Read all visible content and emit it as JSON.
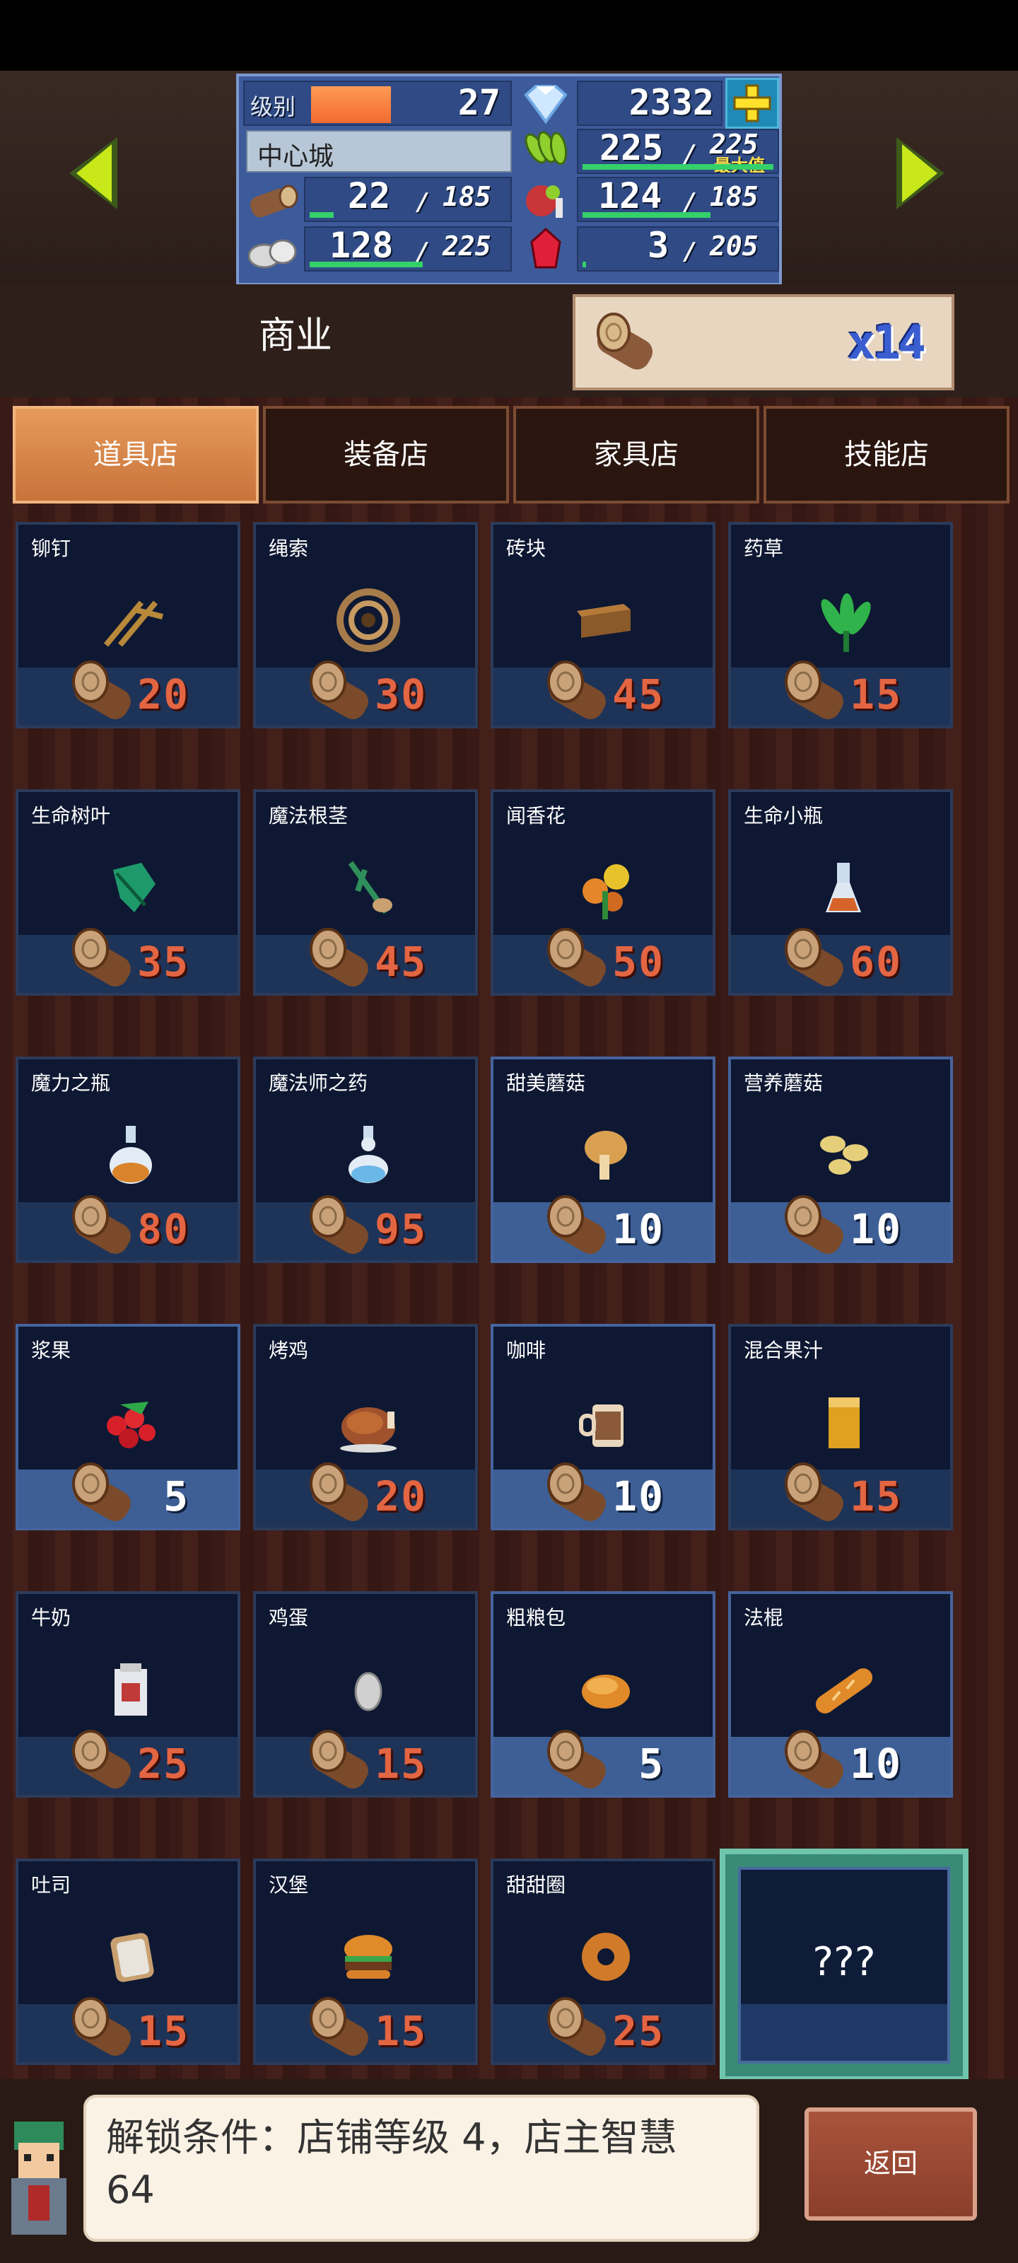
{
  "header": {
    "level_label": "级别",
    "level": "27",
    "level_progress": 0.45,
    "gems": "2332",
    "city": "中心城",
    "wheat": {
      "value": "225",
      "slash": "/",
      "max": "225",
      "max_label": "最大值",
      "fill": 1.0
    },
    "wood": {
      "value": "22",
      "slash": "/",
      "max": "185",
      "fill": 0.12
    },
    "meat": {
      "value": "124",
      "slash": "/",
      "max": "185",
      "fill": 0.67
    },
    "stone": {
      "value": "128",
      "slash": "/",
      "max": "225",
      "fill": 0.57
    },
    "ruby": {
      "value": "3",
      "slash": "/",
      "max": "205",
      "fill": 0.02
    }
  },
  "section_title": "商业",
  "currency": {
    "icon": "wood-log-icon",
    "quantity": "x14"
  },
  "tabs": [
    "道具店",
    "装备店",
    "家具店",
    "技能店"
  ],
  "active_tab": 0,
  "items": [
    {
      "name": "铆钉",
      "price": "20",
      "icon": "rivet-icon",
      "affordable": false
    },
    {
      "name": "绳索",
      "price": "30",
      "icon": "rope-icon",
      "affordable": false
    },
    {
      "name": "砖块",
      "price": "45",
      "icon": "brick-icon",
      "affordable": false
    },
    {
      "name": "药草",
      "price": "15",
      "icon": "herb-icon",
      "affordable": false
    },
    {
      "name": "生命树叶",
      "price": "35",
      "icon": "leaf-icon",
      "affordable": false
    },
    {
      "name": "魔法根茎",
      "price": "45",
      "icon": "root-icon",
      "affordable": false
    },
    {
      "name": "闻香花",
      "price": "50",
      "icon": "flower-icon",
      "affordable": false
    },
    {
      "name": "生命小瓶",
      "price": "60",
      "icon": "small-potion-icon",
      "affordable": false
    },
    {
      "name": "魔力之瓶",
      "price": "80",
      "icon": "mana-bottle-icon",
      "affordable": false
    },
    {
      "name": "魔法师之药",
      "price": "95",
      "icon": "mage-potion-icon",
      "affordable": false
    },
    {
      "name": "甜美蘑菇",
      "price": "10",
      "icon": "mushroom-icon",
      "affordable": true
    },
    {
      "name": "营养蘑菇",
      "price": "10",
      "icon": "mushrooms-icon",
      "affordable": true
    },
    {
      "name": "浆果",
      "price": "5",
      "icon": "berry-icon",
      "affordable": true
    },
    {
      "name": "烤鸡",
      "price": "20",
      "icon": "roast-chicken-icon",
      "affordable": false
    },
    {
      "name": "咖啡",
      "price": "10",
      "icon": "coffee-icon",
      "affordable": true
    },
    {
      "name": "混合果汁",
      "price": "15",
      "icon": "juice-icon",
      "affordable": false
    },
    {
      "name": "牛奶",
      "price": "25",
      "icon": "milk-icon",
      "affordable": false
    },
    {
      "name": "鸡蛋",
      "price": "15",
      "icon": "egg-icon",
      "affordable": false
    },
    {
      "name": "粗粮包",
      "price": "5",
      "icon": "bun-icon",
      "affordable": true
    },
    {
      "name": "法棍",
      "price": "10",
      "icon": "baguette-icon",
      "affordable": true
    },
    {
      "name": "吐司",
      "price": "15",
      "icon": "toast-icon",
      "affordable": false
    },
    {
      "name": "汉堡",
      "price": "15",
      "icon": "burger-icon",
      "affordable": false
    },
    {
      "name": "甜甜圈",
      "price": "25",
      "icon": "donut-icon",
      "affordable": false
    }
  ],
  "locked_item": {
    "label": "???"
  },
  "unlock_message": "解锁条件：店铺等级 4，店主智慧 64",
  "back_button": "返回",
  "colors": {
    "accent_orange": "#e69a5b",
    "price_red": "#e36542",
    "panel_blue": "#3d5a9a"
  }
}
